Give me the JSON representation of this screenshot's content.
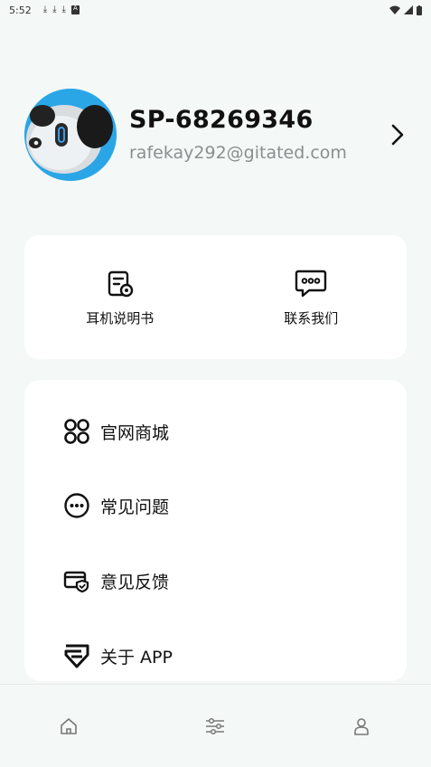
{
  "status_bar": {
    "time": "5:52",
    "icons": [
      "download-icon",
      "download-icon",
      "download-icon",
      "a-icon"
    ],
    "right_icons": [
      "wifi-icon",
      "signal-icon",
      "battery-icon"
    ]
  },
  "profile": {
    "name": "SP-68269346",
    "email": "rafekay292@gitated.com"
  },
  "quick_actions": [
    {
      "label": "耳机说明书",
      "icon": "manual-icon"
    },
    {
      "label": "联系我们",
      "icon": "chat-icon"
    }
  ],
  "menu": [
    {
      "label": "官网商城",
      "icon": "grid-icon"
    },
    {
      "label": "常见问题",
      "icon": "ellipsis-circle-icon"
    },
    {
      "label": "意见反馈",
      "icon": "feedback-card-icon"
    },
    {
      "label": "关于 APP",
      "icon": "brand-s-icon"
    }
  ],
  "bottom_nav": [
    {
      "name": "home",
      "icon": "home-icon"
    },
    {
      "name": "settings",
      "icon": "sliders-icon"
    },
    {
      "name": "profile",
      "icon": "person-icon"
    }
  ],
  "colors": {
    "background": "#f4f8f7",
    "card": "#ffffff",
    "avatar_accent": "#2aa6e6",
    "text_primary": "#111111",
    "text_secondary": "#8a8f8f"
  }
}
